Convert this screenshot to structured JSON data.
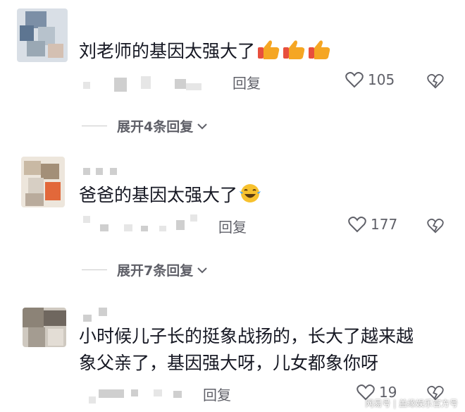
{
  "comments": [
    {
      "text": "刘老师的基因太强大了",
      "emoji": [
        "thumbs-up-icon",
        "thumbs-up-icon",
        "thumbs-up-icon"
      ],
      "reply_label": "回复",
      "likes": "105",
      "expand_label": "展开4条回复"
    },
    {
      "text": "爸爸的基因太强大了",
      "emoji": [
        "laughing-tears-icon"
      ],
      "reply_label": "回复",
      "likes": "177",
      "expand_label": "展开7条回复"
    },
    {
      "text_line1": "小时候儿子长的挺象战扬的，长大了越来越",
      "text_line2": "象父亲了，基因强大呀，儿女都象你呀",
      "reply_label": "回复",
      "likes": "19"
    }
  ],
  "watermark": "网易号 | 盖缘娱乐官方号",
  "colors": {
    "like_gray": "#5f6068",
    "thumb": "#f5a623",
    "thumb_cuff": "#e84f3d"
  }
}
